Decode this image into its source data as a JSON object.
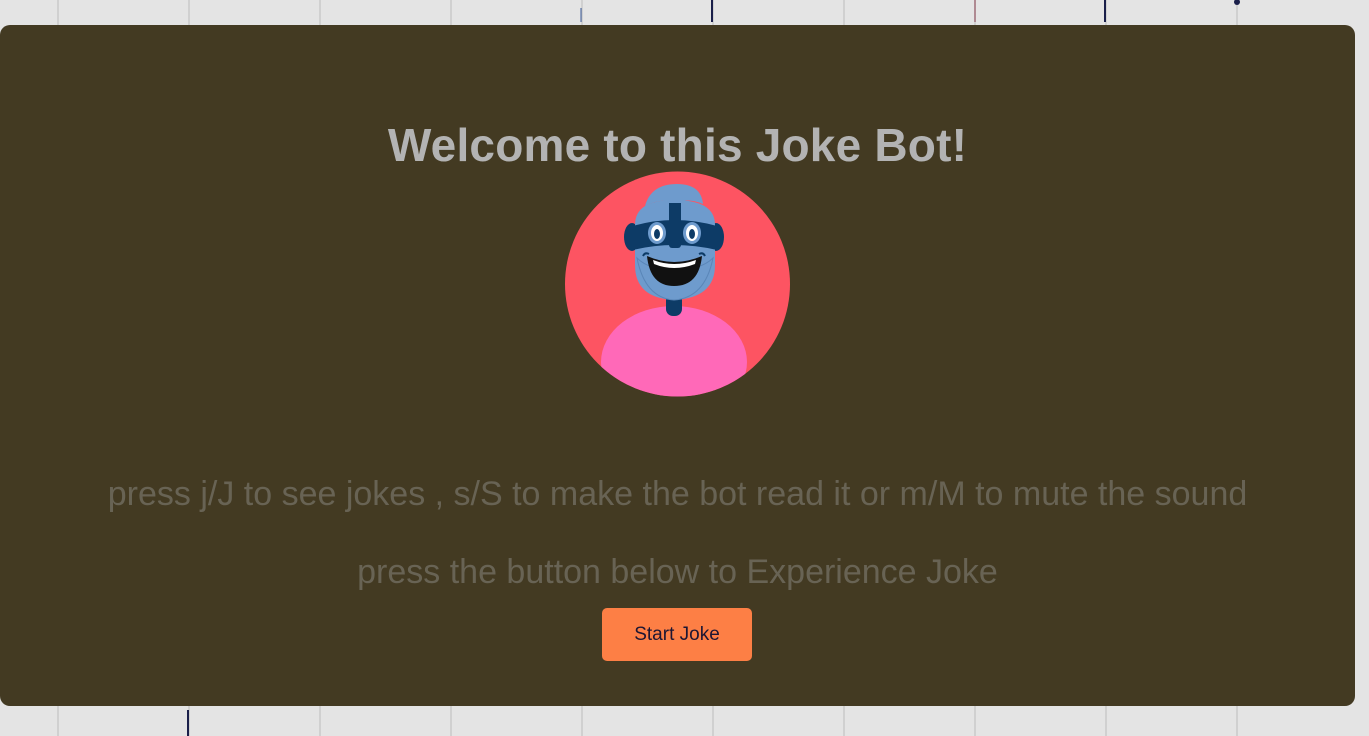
{
  "page": {
    "title": "Welcome to this Joke Bot!",
    "instructions": "press j/J to see jokes , s/S to make the bot read it or m/M to mute the sound",
    "prompt": "press the button below to Experience Joke",
    "start_button_label": "Start Joke"
  },
  "avatar": {
    "icon": "bot-face-icon"
  },
  "colors": {
    "page_background": "#e4e4e4",
    "card_background": "#433a22",
    "title_text": "#b3b3b3",
    "body_text": "#686354",
    "button_background": "#fd7f45",
    "button_text": "#1d1633",
    "avatar_circle": "#fd5462",
    "avatar_shirt": "#ff69b8",
    "avatar_skin": "#6e9bcd",
    "avatar_dark": "#0d3b66"
  }
}
